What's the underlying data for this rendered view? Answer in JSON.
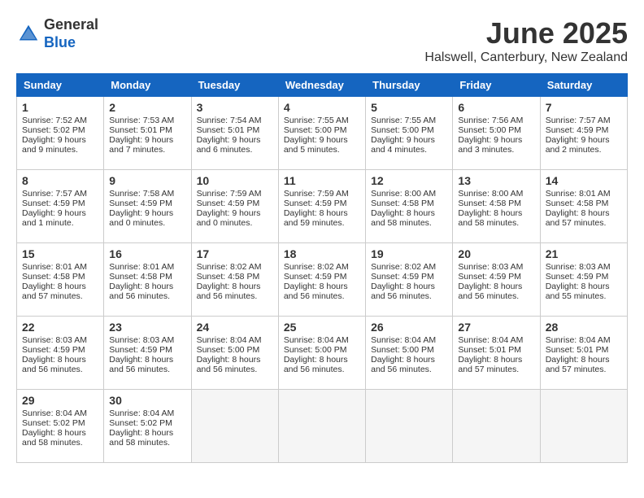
{
  "logo": {
    "general": "General",
    "blue": "Blue"
  },
  "title": "June 2025",
  "location": "Halswell, Canterbury, New Zealand",
  "days_of_week": [
    "Sunday",
    "Monday",
    "Tuesday",
    "Wednesday",
    "Thursday",
    "Friday",
    "Saturday"
  ],
  "weeks": [
    [
      {
        "day": 1,
        "lines": [
          "Sunrise: 7:52 AM",
          "Sunset: 5:02 PM",
          "Daylight: 9 hours",
          "and 9 minutes."
        ]
      },
      {
        "day": 2,
        "lines": [
          "Sunrise: 7:53 AM",
          "Sunset: 5:01 PM",
          "Daylight: 9 hours",
          "and 7 minutes."
        ]
      },
      {
        "day": 3,
        "lines": [
          "Sunrise: 7:54 AM",
          "Sunset: 5:01 PM",
          "Daylight: 9 hours",
          "and 6 minutes."
        ]
      },
      {
        "day": 4,
        "lines": [
          "Sunrise: 7:55 AM",
          "Sunset: 5:00 PM",
          "Daylight: 9 hours",
          "and 5 minutes."
        ]
      },
      {
        "day": 5,
        "lines": [
          "Sunrise: 7:55 AM",
          "Sunset: 5:00 PM",
          "Daylight: 9 hours",
          "and 4 minutes."
        ]
      },
      {
        "day": 6,
        "lines": [
          "Sunrise: 7:56 AM",
          "Sunset: 5:00 PM",
          "Daylight: 9 hours",
          "and 3 minutes."
        ]
      },
      {
        "day": 7,
        "lines": [
          "Sunrise: 7:57 AM",
          "Sunset: 4:59 PM",
          "Daylight: 9 hours",
          "and 2 minutes."
        ]
      }
    ],
    [
      {
        "day": 8,
        "lines": [
          "Sunrise: 7:57 AM",
          "Sunset: 4:59 PM",
          "Daylight: 9 hours",
          "and 1 minute."
        ]
      },
      {
        "day": 9,
        "lines": [
          "Sunrise: 7:58 AM",
          "Sunset: 4:59 PM",
          "Daylight: 9 hours",
          "and 0 minutes."
        ]
      },
      {
        "day": 10,
        "lines": [
          "Sunrise: 7:59 AM",
          "Sunset: 4:59 PM",
          "Daylight: 9 hours",
          "and 0 minutes."
        ]
      },
      {
        "day": 11,
        "lines": [
          "Sunrise: 7:59 AM",
          "Sunset: 4:59 PM",
          "Daylight: 8 hours",
          "and 59 minutes."
        ]
      },
      {
        "day": 12,
        "lines": [
          "Sunrise: 8:00 AM",
          "Sunset: 4:58 PM",
          "Daylight: 8 hours",
          "and 58 minutes."
        ]
      },
      {
        "day": 13,
        "lines": [
          "Sunrise: 8:00 AM",
          "Sunset: 4:58 PM",
          "Daylight: 8 hours",
          "and 58 minutes."
        ]
      },
      {
        "day": 14,
        "lines": [
          "Sunrise: 8:01 AM",
          "Sunset: 4:58 PM",
          "Daylight: 8 hours",
          "and 57 minutes."
        ]
      }
    ],
    [
      {
        "day": 15,
        "lines": [
          "Sunrise: 8:01 AM",
          "Sunset: 4:58 PM",
          "Daylight: 8 hours",
          "and 57 minutes."
        ]
      },
      {
        "day": 16,
        "lines": [
          "Sunrise: 8:01 AM",
          "Sunset: 4:58 PM",
          "Daylight: 8 hours",
          "and 56 minutes."
        ]
      },
      {
        "day": 17,
        "lines": [
          "Sunrise: 8:02 AM",
          "Sunset: 4:58 PM",
          "Daylight: 8 hours",
          "and 56 minutes."
        ]
      },
      {
        "day": 18,
        "lines": [
          "Sunrise: 8:02 AM",
          "Sunset: 4:59 PM",
          "Daylight: 8 hours",
          "and 56 minutes."
        ]
      },
      {
        "day": 19,
        "lines": [
          "Sunrise: 8:02 AM",
          "Sunset: 4:59 PM",
          "Daylight: 8 hours",
          "and 56 minutes."
        ]
      },
      {
        "day": 20,
        "lines": [
          "Sunrise: 8:03 AM",
          "Sunset: 4:59 PM",
          "Daylight: 8 hours",
          "and 56 minutes."
        ]
      },
      {
        "day": 21,
        "lines": [
          "Sunrise: 8:03 AM",
          "Sunset: 4:59 PM",
          "Daylight: 8 hours",
          "and 55 minutes."
        ]
      }
    ],
    [
      {
        "day": 22,
        "lines": [
          "Sunrise: 8:03 AM",
          "Sunset: 4:59 PM",
          "Daylight: 8 hours",
          "and 56 minutes."
        ]
      },
      {
        "day": 23,
        "lines": [
          "Sunrise: 8:03 AM",
          "Sunset: 4:59 PM",
          "Daylight: 8 hours",
          "and 56 minutes."
        ]
      },
      {
        "day": 24,
        "lines": [
          "Sunrise: 8:04 AM",
          "Sunset: 5:00 PM",
          "Daylight: 8 hours",
          "and 56 minutes."
        ]
      },
      {
        "day": 25,
        "lines": [
          "Sunrise: 8:04 AM",
          "Sunset: 5:00 PM",
          "Daylight: 8 hours",
          "and 56 minutes."
        ]
      },
      {
        "day": 26,
        "lines": [
          "Sunrise: 8:04 AM",
          "Sunset: 5:00 PM",
          "Daylight: 8 hours",
          "and 56 minutes."
        ]
      },
      {
        "day": 27,
        "lines": [
          "Sunrise: 8:04 AM",
          "Sunset: 5:01 PM",
          "Daylight: 8 hours",
          "and 57 minutes."
        ]
      },
      {
        "day": 28,
        "lines": [
          "Sunrise: 8:04 AM",
          "Sunset: 5:01 PM",
          "Daylight: 8 hours",
          "and 57 minutes."
        ]
      }
    ],
    [
      {
        "day": 29,
        "lines": [
          "Sunrise: 8:04 AM",
          "Sunset: 5:02 PM",
          "Daylight: 8 hours",
          "and 58 minutes."
        ]
      },
      {
        "day": 30,
        "lines": [
          "Sunrise: 8:04 AM",
          "Sunset: 5:02 PM",
          "Daylight: 8 hours",
          "and 58 minutes."
        ]
      },
      null,
      null,
      null,
      null,
      null
    ]
  ]
}
